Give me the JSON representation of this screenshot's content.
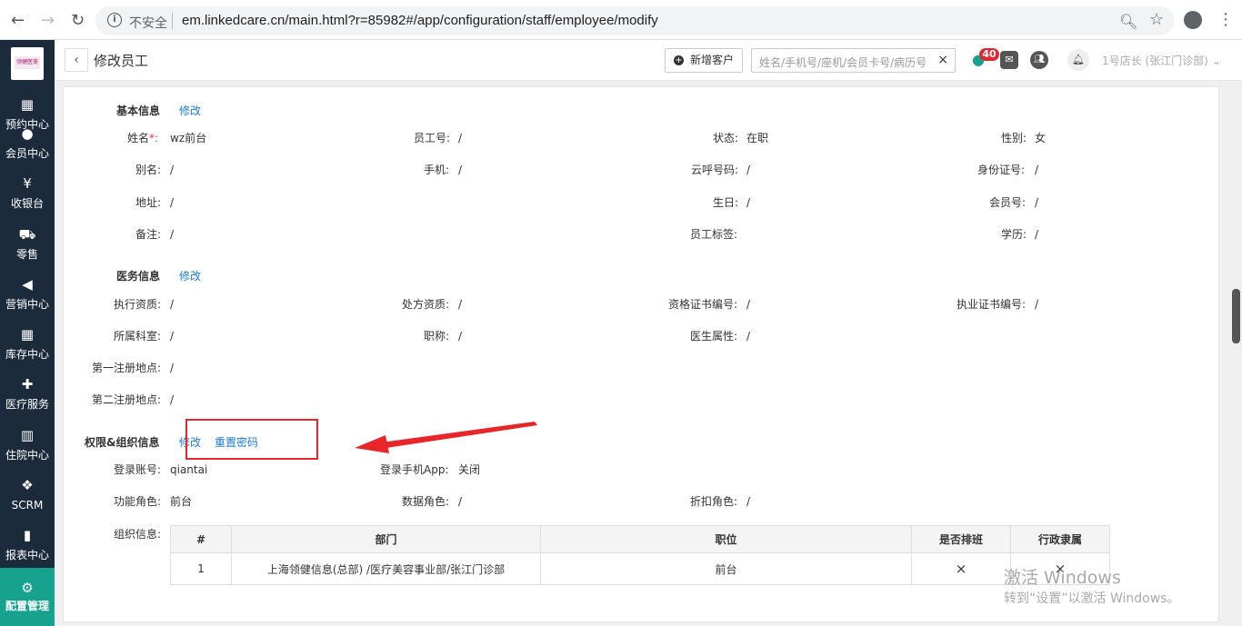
{
  "browser": {
    "security": "不安全",
    "url": "em.linkedcare.cn/main.html?r=85982#/app/configuration/staff/employee/modify"
  },
  "sidebar": {
    "logo_text": "领健医美",
    "items": [
      {
        "label": "预约中心",
        "icon": "calendar-icon"
      },
      {
        "label": "会员中心",
        "icon": "members-icon"
      },
      {
        "label": "收银台",
        "icon": "yuan-icon"
      },
      {
        "label": "零售",
        "icon": "cart-icon"
      },
      {
        "label": "营销中心",
        "icon": "megaphone-icon"
      },
      {
        "label": "库存中心",
        "icon": "grid-icon"
      },
      {
        "label": "医疗服务",
        "icon": "medkit-icon"
      },
      {
        "label": "住院中心",
        "icon": "building-icon"
      },
      {
        "label": "SCRM",
        "icon": "cubes-icon"
      },
      {
        "label": "报表中心",
        "icon": "bar-chart-icon"
      },
      {
        "label": "配置管理",
        "icon": "gear-icon"
      }
    ],
    "active_color": "#16a28f"
  },
  "header": {
    "back": "‹",
    "title": "修改员工",
    "new_customer": "新增客户",
    "search_placeholder": "姓名/手机号/座机/会员卡号/病历号",
    "clear": "×",
    "badge": "40",
    "store": "1号店长 (张江门诊部)"
  },
  "basic": {
    "title": "基本信息",
    "edit": "修改",
    "fields": {
      "name_label": "姓名",
      "required": "*:",
      "name": "wz前台",
      "empno_label": "员工号:",
      "empno": "/",
      "status_label": "状态:",
      "status": "在职",
      "gender_label": "性别:",
      "gender": "女",
      "alias_label": "别名:",
      "alias": "/",
      "mobile_label": "手机:",
      "mobile": "/",
      "cloud_label": "云呼号码:",
      "cloud": "/",
      "idcard_label": "身份证号:",
      "idcard": "/",
      "addr_label": "地址:",
      "addr": "/",
      "birthday_label": "生日:",
      "birthday": "/",
      "member_label": "会员号:",
      "member": "/",
      "remark_label": "备注:",
      "remark": "/",
      "tag_label": "员工标签:",
      "tag": "",
      "edu_label": "学历:",
      "edu": "/"
    }
  },
  "medical": {
    "title": "医务信息",
    "edit": "修改",
    "fields": {
      "practice_label": "执行资质:",
      "practice": "/",
      "rx_label": "处方资质:",
      "rx": "/",
      "cert_label": "资格证书编号:",
      "cert": "/",
      "license_label": "执业证书编号:",
      "license": "/",
      "dept_label": "所属科室:",
      "dept": "/",
      "title_label": "职称:",
      "title": "/",
      "doctor_label": "医生属性:",
      "doctor": "/",
      "reg1_label": "第一注册地点:",
      "reg1": "/",
      "reg2_label": "第二注册地点:",
      "reg2": "/"
    }
  },
  "perm": {
    "title": "权限&组织信息",
    "edit": "修改",
    "reset": "重置密码",
    "fields": {
      "account_label": "登录账号:",
      "account": "qiantai",
      "app_label": "登录手机App:",
      "app": "关闭",
      "role_label": "功能角色:",
      "role": "前台",
      "datarole_label": "数据角色:",
      "datarole": "/",
      "discount_label": "折扣角色:",
      "discount": "/",
      "org_label": "组织信息:"
    }
  },
  "org_table": {
    "headers": [
      "#",
      "部门",
      "职位",
      "是否排班",
      "行政隶属"
    ],
    "rows": [
      [
        "1",
        "上海领健信息(总部) /医疗美容事业部/张江门诊部",
        "前台",
        "×",
        "×"
      ]
    ]
  },
  "watermark": {
    "line1": "激活 Windows",
    "line2": "转到“设置”以激活 Windows。"
  }
}
